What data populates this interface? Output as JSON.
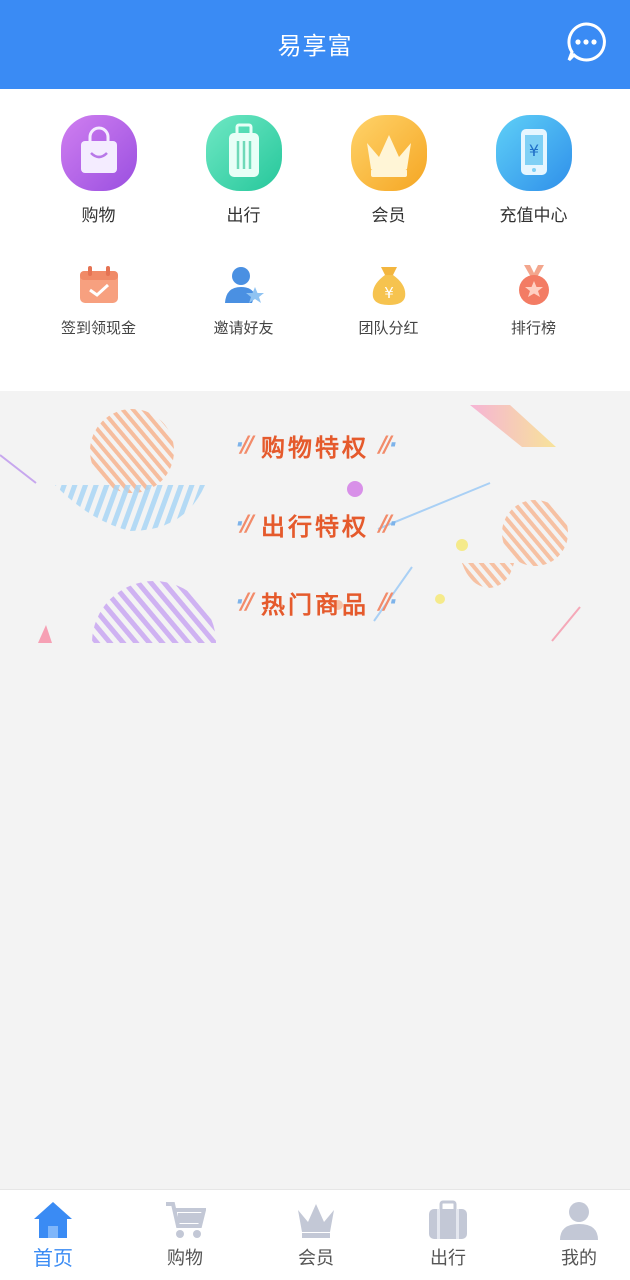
{
  "header": {
    "title": "易享富",
    "message_icon": "message-dots-icon"
  },
  "features": [
    {
      "label": "购物",
      "icon": "shopping-bag-icon",
      "color": "#b266e6"
    },
    {
      "label": "出行",
      "icon": "luggage-icon",
      "color": "#3fd6ae"
    },
    {
      "label": "会员",
      "icon": "crown-icon",
      "color": "#f6b33a"
    },
    {
      "label": "充值中心",
      "icon": "phone-recharge-icon",
      "color": "#3aa7ef"
    }
  ],
  "quick_actions": [
    {
      "label": "签到领现金",
      "icon": "calendar-checkin-icon"
    },
    {
      "label": "邀请好友",
      "icon": "invite-friend-icon"
    },
    {
      "label": "团队分红",
      "icon": "money-bag-icon"
    },
    {
      "label": "排行榜",
      "icon": "medal-icon"
    }
  ],
  "sections": [
    {
      "label": "购物特权"
    },
    {
      "label": "出行特权"
    },
    {
      "label": "热门商品"
    }
  ],
  "tabbar": {
    "accent": "#3a8bf4",
    "inactive": "#c3c8d6",
    "items": [
      {
        "label": "首页",
        "icon": "home-icon",
        "active": true
      },
      {
        "label": "购物",
        "icon": "cart-icon",
        "active": false
      },
      {
        "label": "会员",
        "icon": "crown-icon",
        "active": false
      },
      {
        "label": "出行",
        "icon": "luggage-icon",
        "active": false
      },
      {
        "label": "我的",
        "icon": "user-icon",
        "active": false
      }
    ]
  }
}
